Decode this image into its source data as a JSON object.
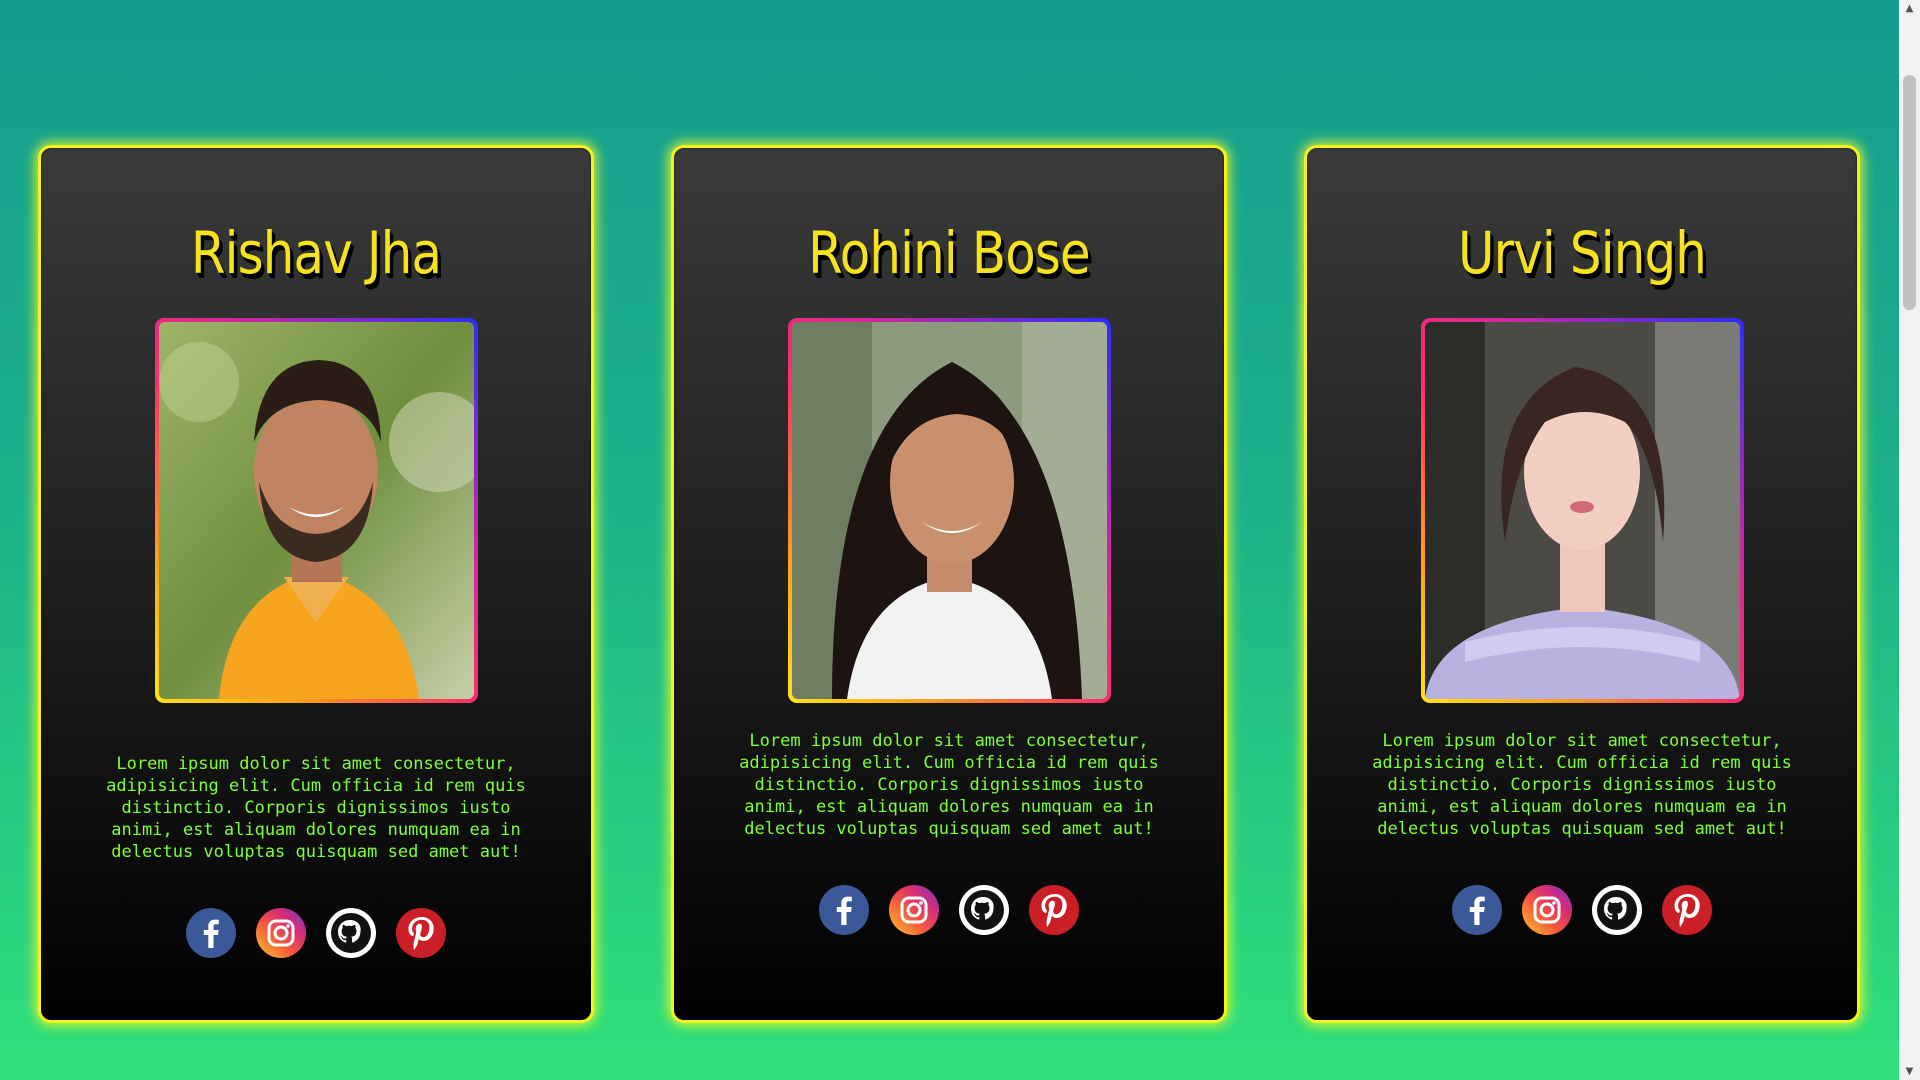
{
  "cards": [
    {
      "name": "Rishav Jha",
      "photo_alt": "Rishav Jha photo",
      "bio": "Lorem ipsum dolor sit amet consectetur, adipisicing elit. Cum officia id rem quis distinctio. Corporis dignissimos iusto animi, est aliquam dolores numquam ea in delectus voluptas quisquam sed amet aut!",
      "socials": [
        "facebook-icon",
        "instagram-icon",
        "github-icon",
        "pinterest-icon"
      ]
    },
    {
      "name": "Rohini Bose",
      "photo_alt": "Rohini Bose photo",
      "bio": "Lorem ipsum dolor sit amet consectetur, adipisicing elit. Cum officia id rem quis distinctio. Corporis dignissimos iusto animi, est aliquam dolores numquam ea in delectus voluptas quisquam sed amet aut!",
      "socials": [
        "facebook-icon",
        "instagram-icon",
        "github-icon",
        "pinterest-icon"
      ]
    },
    {
      "name": "Urvi Singh",
      "photo_alt": "Urvi Singh photo",
      "bio": "Lorem ipsum dolor sit amet consectetur, adipisicing elit. Cum officia id rem quis distinctio. Corporis dignissimos iusto animi, est aliquam dolores numquam ea in delectus voluptas quisquam sed amet aut!",
      "socials": [
        "facebook-icon",
        "instagram-icon",
        "github-icon",
        "pinterest-icon"
      ]
    }
  ],
  "colors": {
    "page_gradient_top": "#149c8e",
    "page_gradient_bottom": "#2fe07a",
    "card_border": "#f6f21d",
    "name_color": "#f6e21d",
    "bio_color": "#7dff3a",
    "facebook": "#3b5998",
    "pinterest": "#cb1f27"
  }
}
